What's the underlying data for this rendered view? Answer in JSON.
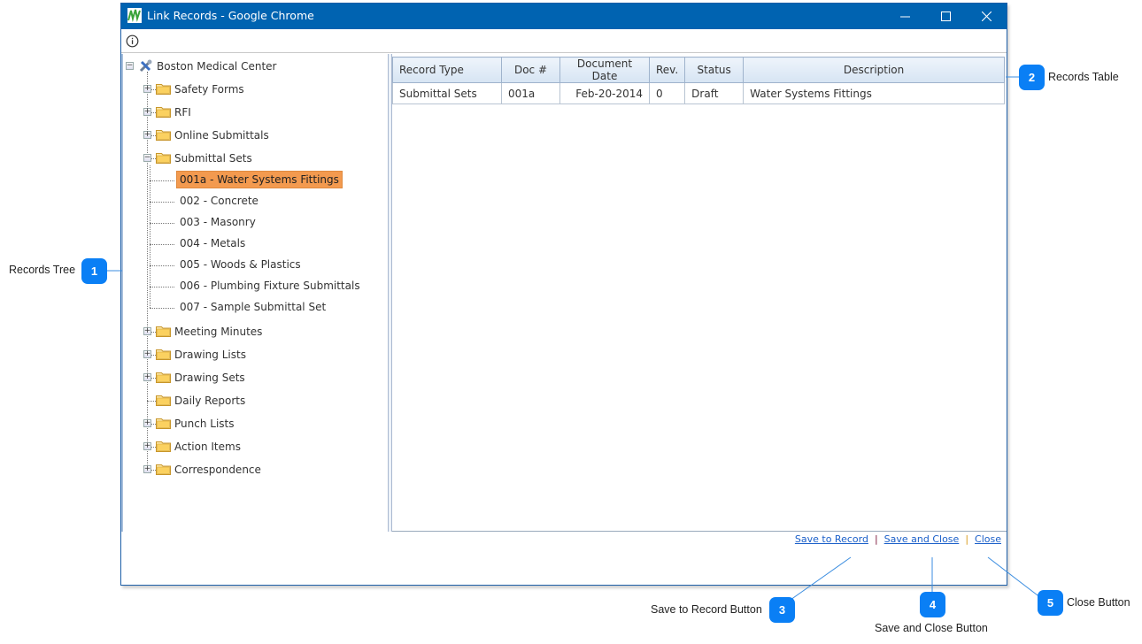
{
  "window": {
    "title": "Link Records - Google Chrome",
    "controls": {
      "minimize": "minimize",
      "maximize": "maximize",
      "close": "close"
    }
  },
  "toolbar": {
    "info_icon": "info-icon"
  },
  "tree": {
    "root": {
      "label": "Boston Medical Center",
      "icon": "project-tools-icon",
      "expanded": true
    },
    "folders": [
      {
        "label": "Safety Forms",
        "expanded": false,
        "has_children": true
      },
      {
        "label": "RFI",
        "expanded": false,
        "has_children": true
      },
      {
        "label": "Online Submittals",
        "expanded": false,
        "has_children": true
      },
      {
        "label": "Submittal Sets",
        "expanded": true,
        "has_children": true
      },
      {
        "label": "Meeting Minutes",
        "expanded": false,
        "has_children": true
      },
      {
        "label": "Drawing Lists",
        "expanded": false,
        "has_children": true
      },
      {
        "label": "Drawing Sets",
        "expanded": false,
        "has_children": true
      },
      {
        "label": "Daily Reports",
        "expanded": false,
        "has_children": false
      },
      {
        "label": "Punch Lists",
        "expanded": false,
        "has_children": true
      },
      {
        "label": "Action Items",
        "expanded": false,
        "has_children": true
      },
      {
        "label": "Correspondence",
        "expanded": false,
        "has_children": true
      }
    ],
    "submittal_sets_children": [
      {
        "label": "001a - Water Systems Fittings",
        "selected": true
      },
      {
        "label": "002 - Concrete",
        "selected": false
      },
      {
        "label": "003 - Masonry",
        "selected": false
      },
      {
        "label": "004 - Metals",
        "selected": false
      },
      {
        "label": "005 - Woods & Plastics",
        "selected": false
      },
      {
        "label": "006 - Plumbing Fixture Submittals",
        "selected": false
      },
      {
        "label": "007 - Sample Submittal Set",
        "selected": false
      }
    ],
    "selected_color": "#f39a4f"
  },
  "table": {
    "columns": [
      "Record Type",
      "Doc #",
      "Document Date",
      "Rev.",
      "Status",
      "Description"
    ],
    "rows": [
      [
        "Submittal Sets",
        "001a",
        "Feb-20-2014",
        "0",
        "Draft",
        "Water Systems Fittings"
      ]
    ]
  },
  "footer": {
    "save_to_record": "Save to Record",
    "save_and_close": "Save and Close",
    "close": "Close",
    "separator": "|"
  },
  "callouts": [
    {
      "number": "1",
      "label": "Records Tree"
    },
    {
      "number": "2",
      "label": "Records Table"
    },
    {
      "number": "3",
      "label": "Save to Record Button"
    },
    {
      "number": "4",
      "label": "Save and Close Button"
    },
    {
      "number": "5",
      "label": "Close Button"
    }
  ],
  "colors": {
    "titlebar": "#0063b1",
    "callout": "#0a7ff5",
    "link": "#1a5fc9"
  }
}
